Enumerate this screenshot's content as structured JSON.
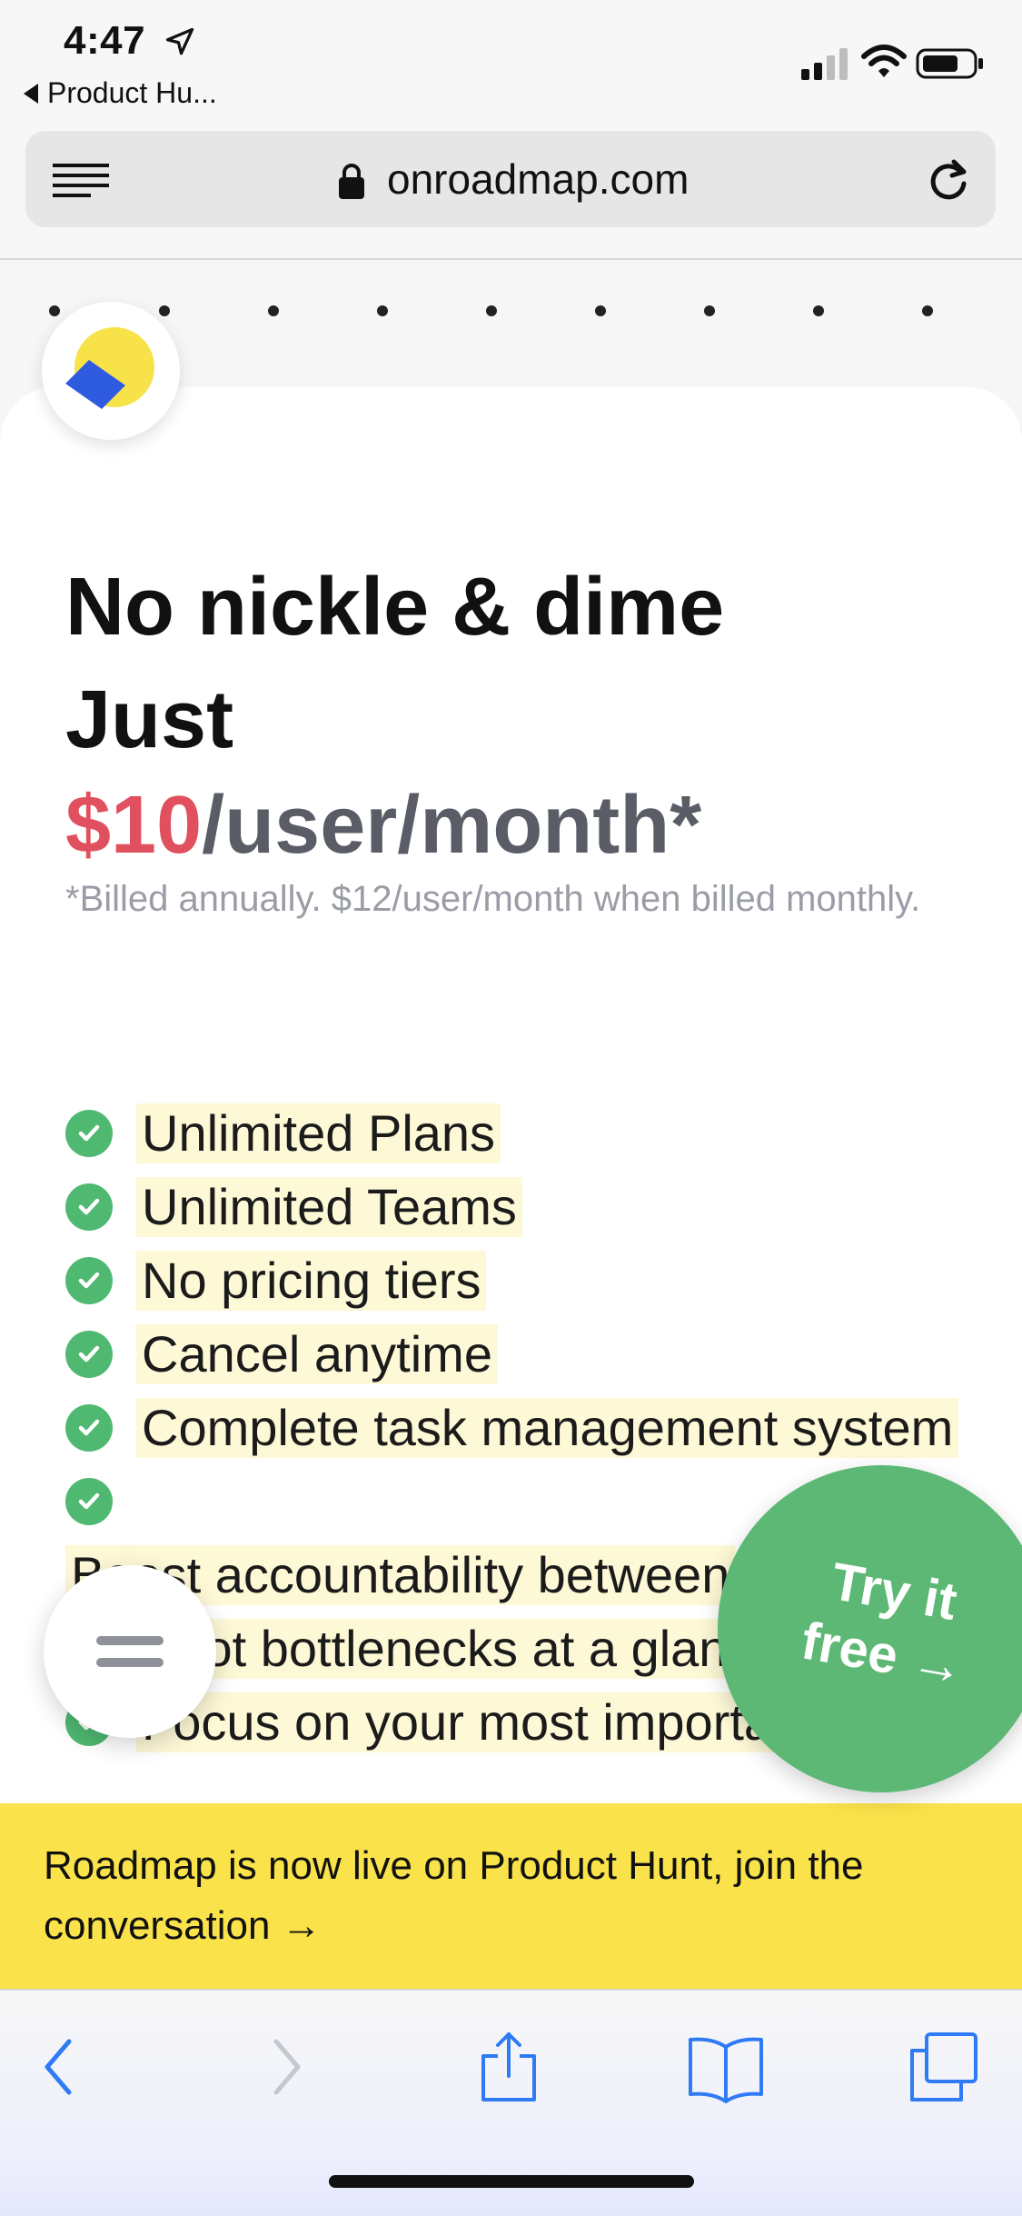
{
  "status_bar": {
    "time": "4:47",
    "back_app": "Product Hu..."
  },
  "url_bar": {
    "url": "onroadmap.com"
  },
  "hero": {
    "line1": "No nickle & dime",
    "line2": "Just",
    "price_amount": "$10",
    "price_unit": "/user/month*",
    "billing_note": "*Billed annually. $12/user/month when billed monthly."
  },
  "features": [
    "Unlimited Plans",
    "Unlimited Teams",
    "No pricing tiers",
    "Cancel anytime",
    "Complete task management system",
    "",
    "Boost accountability between",
    "Spot bottlenecks at a glance",
    "Focus on your most important"
  ],
  "cta": {
    "try_label": "Try it free →"
  },
  "banner": {
    "text": "Roadmap is now live on Product Hunt, join the conversation →"
  },
  "colors": {
    "price_accent": "#e0505e",
    "check_green": "#4fb971",
    "cta_green": "#5cb874",
    "banner_yellow": "#fae34a",
    "ios_blue": "#2f7bf6"
  },
  "icons": {
    "toolbar": [
      "back-icon",
      "forward-icon",
      "share-icon",
      "bookmarks-icon",
      "tabs-icon"
    ]
  }
}
